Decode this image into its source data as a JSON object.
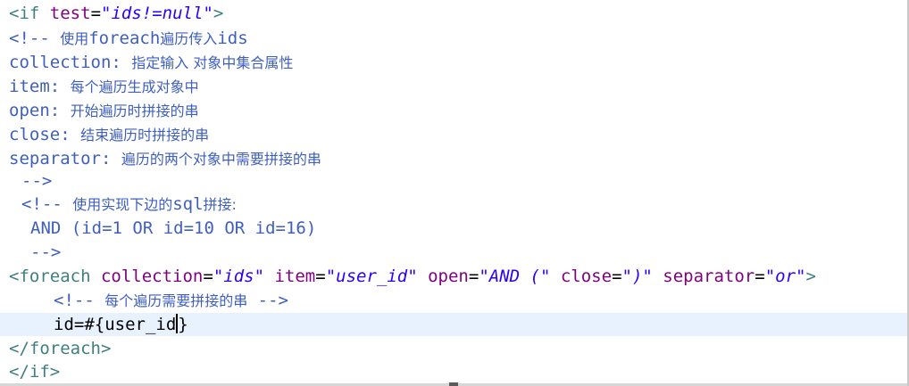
{
  "code": {
    "if_open": {
      "lt": "<",
      "tag": "if",
      "attr": "test",
      "eq": "=",
      "value": "\"ids!=null\"",
      "gt": ">"
    },
    "c1_open": "<!-- ",
    "c1_cjk1": "使用",
    "c1_mid": "foreach",
    "c1_cjk2": "遍历传入",
    "c1_end": "ids",
    "c2_a": "collection: ",
    "c2_b": "指定输入 对象中集合属性",
    "c3_a": "item: ",
    "c3_b": "每个遍历生成对象中",
    "c4_a": "open: ",
    "c4_b": "开始遍历时拼接的串",
    "c5_a": "close: ",
    "c5_b": "结束遍历时拼接的串",
    "c6_a": "separator: ",
    "c6_b": "遍历的两个对象中需要拼接的串",
    "c7": "-->",
    "c8_a": "<!-- ",
    "c8_b": "使用实现下边的",
    "c8_c": "sql",
    "c8_d": "拼接:",
    "c9": "AND (id=1 OR id=10 OR id=16)",
    "c10": "-->",
    "foreach_open": {
      "lt": "<",
      "tag": "foreach",
      "attr1": "collection",
      "val1": "\"ids\"",
      "attr2": "item",
      "val2": "\"user_id\"",
      "attr3": "open",
      "val3": "\"AND (\"",
      "attr4": "close",
      "val4": "\")\"",
      "attr5": "separator",
      "val5": "\"or\"",
      "eq": "=",
      "gt": ">"
    },
    "c11_a": "<!-- ",
    "c11_b": "每个遍历需要拼接的串",
    "c11_c": " -->",
    "body_before": "id=#{user_id",
    "body_after": "}",
    "foreach_close": "</foreach>",
    "if_close": "</if>"
  }
}
